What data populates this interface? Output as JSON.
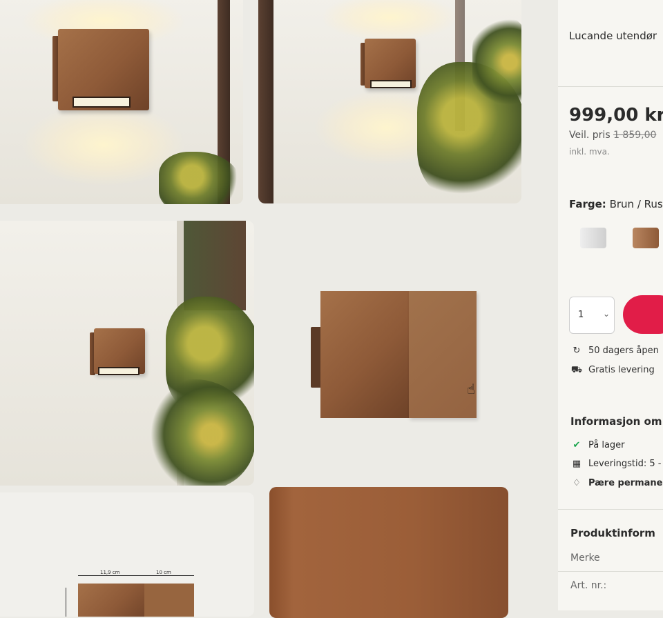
{
  "product": {
    "title": "Lucande utendør",
    "price": "999,00 kr",
    "veil_label": "Veil. pris",
    "veil_price": "1 859,00",
    "vat_note": "inkl. mva.",
    "color_label": "Farge:",
    "color_value": "Brun / Rus",
    "swatches": [
      {
        "name": "grå",
        "color": "#d9d9d9"
      },
      {
        "name": "brun / rust",
        "color": "#a57149"
      }
    ],
    "quantity": "1",
    "buy_button_color": "#e11d48",
    "benefits": [
      {
        "icon": "return-arrow-icon",
        "text": "50 dagers åpen"
      },
      {
        "icon": "truck-icon",
        "text": "Gratis levering"
      }
    ]
  },
  "information": {
    "heading": "Informasjon om",
    "items": [
      {
        "icon": "check-circle-icon",
        "text": "På lager"
      },
      {
        "icon": "calendar-icon",
        "text": "Leveringstid: 5 -"
      },
      {
        "icon": "lightbulb-icon",
        "text": "Pære permane"
      }
    ]
  },
  "product_info": {
    "heading": "Produktinform",
    "rows": [
      "Merke",
      "Art. nr.:"
    ]
  },
  "dimensions": {
    "width_label": "11,9 cm",
    "depth_label": "10 cm"
  }
}
